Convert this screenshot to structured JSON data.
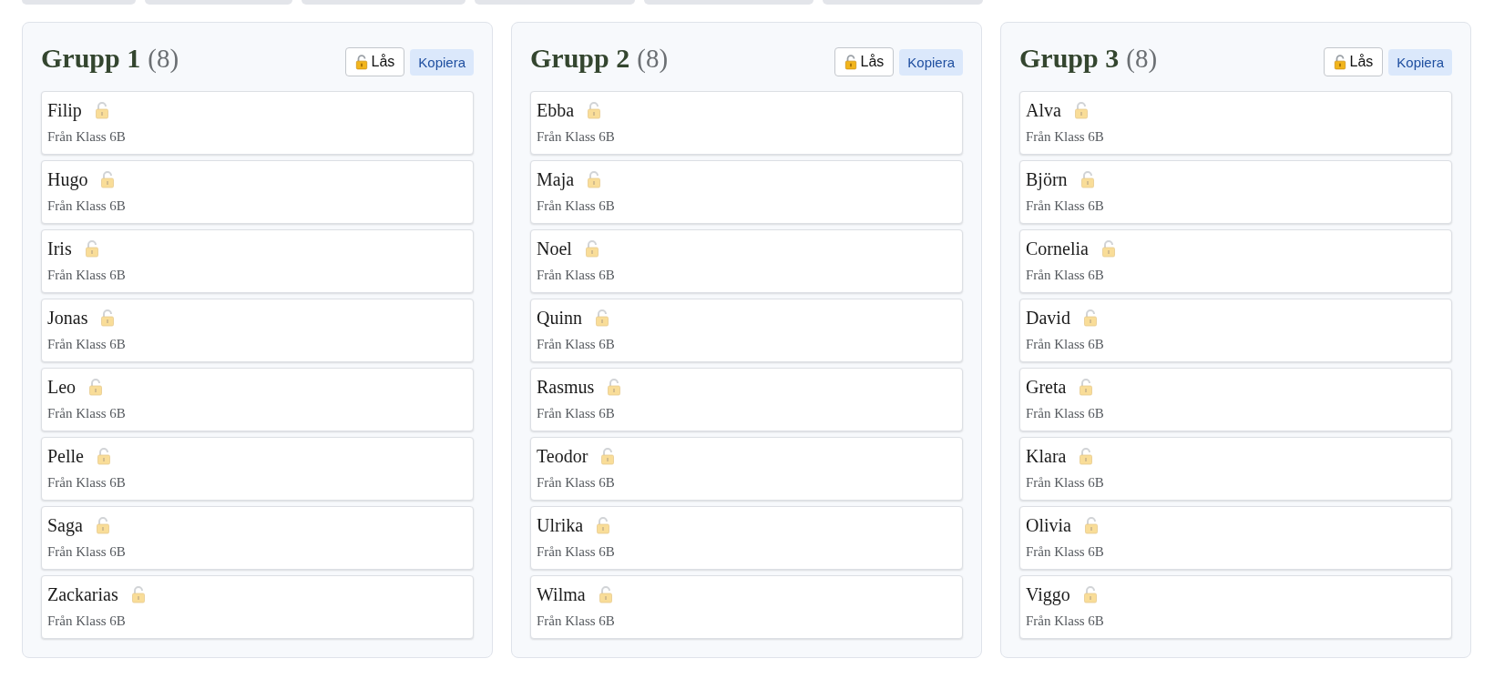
{
  "groups": [
    {
      "title": "Grupp 1",
      "count": "(8)",
      "locked": false,
      "lock_button": "Lås",
      "copy_button": "Kopiera",
      "students": [
        {
          "name": "Filip",
          "origin": "Från Klass 6B",
          "locked": false
        },
        {
          "name": "Hugo",
          "origin": "Från Klass 6B",
          "locked": false
        },
        {
          "name": "Iris",
          "origin": "Från Klass 6B",
          "locked": false
        },
        {
          "name": "Jonas",
          "origin": "Från Klass 6B",
          "locked": false
        },
        {
          "name": "Leo",
          "origin": "Från Klass 6B",
          "locked": false
        },
        {
          "name": "Pelle",
          "origin": "Från Klass 6B",
          "locked": false
        },
        {
          "name": "Saga",
          "origin": "Från Klass 6B",
          "locked": false
        },
        {
          "name": "Zackarias",
          "origin": "Från Klass 6B",
          "locked": false
        }
      ]
    },
    {
      "title": "Grupp 2",
      "count": "(8)",
      "locked": false,
      "lock_button": "Lås",
      "copy_button": "Kopiera",
      "students": [
        {
          "name": "Ebba",
          "origin": "Från Klass 6B",
          "locked": false
        },
        {
          "name": "Maja",
          "origin": "Från Klass 6B",
          "locked": false
        },
        {
          "name": "Noel",
          "origin": "Från Klass 6B",
          "locked": false
        },
        {
          "name": "Quinn",
          "origin": "Från Klass 6B",
          "locked": false
        },
        {
          "name": "Rasmus",
          "origin": "Från Klass 6B",
          "locked": false
        },
        {
          "name": "Teodor",
          "origin": "Från Klass 6B",
          "locked": false
        },
        {
          "name": "Ulrika",
          "origin": "Från Klass 6B",
          "locked": false
        },
        {
          "name": "Wilma",
          "origin": "Från Klass 6B",
          "locked": false
        }
      ]
    },
    {
      "title": "Grupp 3",
      "count": "(8)",
      "locked": false,
      "lock_button": "Lås",
      "copy_button": "Kopiera",
      "students": [
        {
          "name": "Alva",
          "origin": "Från Klass 6B",
          "locked": false
        },
        {
          "name": "Björn",
          "origin": "Från Klass 6B",
          "locked": false
        },
        {
          "name": "Cornelia",
          "origin": "Från Klass 6B",
          "locked": false
        },
        {
          "name": "David",
          "origin": "Från Klass 6B",
          "locked": false
        },
        {
          "name": "Greta",
          "origin": "Från Klass 6B",
          "locked": false
        },
        {
          "name": "Klara",
          "origin": "Från Klass 6B",
          "locked": false
        },
        {
          "name": "Olivia",
          "origin": "Från Klass 6B",
          "locked": false
        },
        {
          "name": "Viggo",
          "origin": "Från Klass 6B",
          "locked": false
        }
      ]
    }
  ]
}
